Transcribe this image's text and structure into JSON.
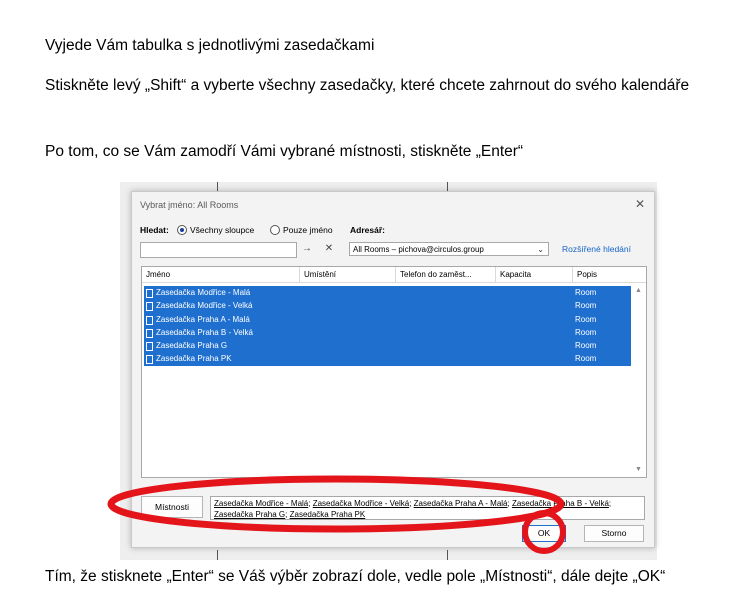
{
  "paragraphs": {
    "p1": "Vyjede Vám tabulka s jednotlivými zasedačkami",
    "p2": "Stiskněte levý „Shift“ a vyberte všechny zasedačky, které chcete zahrnout do svého kalendáře",
    "p3": "Po tom, co se Vám zamodří Vámi vybrané místnosti, stiskněte „Enter“",
    "p4": "Tím, že stisknete „Enter“ se Váš výběr zobrazí dole, vedle pole „Místnosti“, dále dejte „OK“"
  },
  "dialog": {
    "title": "Vybrat jméno: All Rooms",
    "close_glyph": "✕",
    "search_label": "Hledat:",
    "radio_all_label": "Všechny sloupce",
    "radio_name_label": "Pouze jméno",
    "address_label": "Adresář:",
    "search_value": "",
    "go_glyph": "→",
    "clear_glyph": "✕",
    "address_book": "All Rooms – pichova@circulos.group",
    "advanced_link": "Rozšířené hledání",
    "columns": [
      "Jméno",
      "Umístění",
      "Telefon do zaměst...",
      "Kapacita",
      "Popis"
    ],
    "rows": [
      {
        "name": "Zasedačka Modřice - Malá",
        "desc": "Room"
      },
      {
        "name": "Zasedačka Modřice - Velká",
        "desc": "Room"
      },
      {
        "name": "Zasedačka Praha A - Malá",
        "desc": "Room"
      },
      {
        "name": "Zasedačka Praha B - Velká",
        "desc": "Room"
      },
      {
        "name": "Zasedačka Praha G",
        "desc": "Room"
      },
      {
        "name": "Zasedačka Praha PK",
        "desc": "Room"
      }
    ],
    "rooms_button": "Místnosti",
    "selected": [
      "Zasedačka Modřice - Malá",
      "Zasedačka Modřice - Velká",
      "Zasedačka Praha A - Malá",
      "Zasedačka Praha B - Velká",
      "Zasedačka Praha G",
      "Zasedačka Praha PK"
    ],
    "ok_button": "OK",
    "cancel_button": "Storno"
  },
  "colors": {
    "selection": "#1f6fcf",
    "annotation": "#e4141b",
    "link": "#1464c8"
  }
}
